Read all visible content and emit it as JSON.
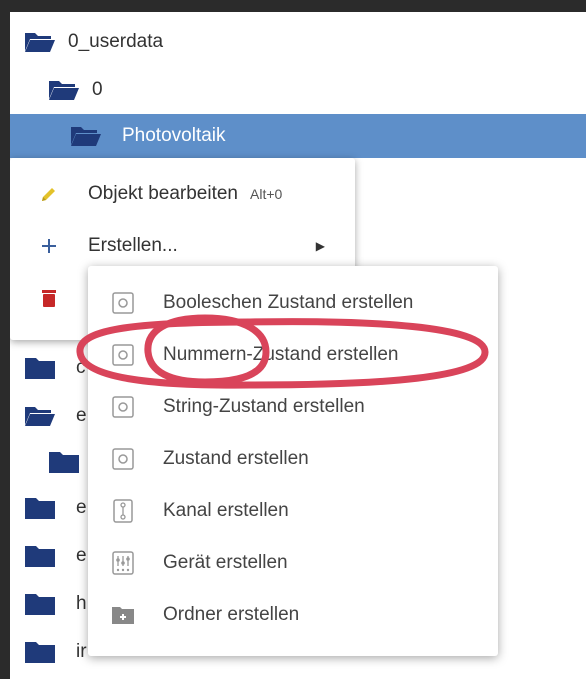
{
  "tree": {
    "items": [
      {
        "label": "0_userdata",
        "icon": "folder-open-icon"
      },
      {
        "label": "0",
        "icon": "folder-open-icon"
      },
      {
        "label": "Photovoltaik",
        "icon": "folder-open-icon",
        "selected": true
      }
    ],
    "partial_items": [
      {
        "label": "c",
        "icon": "folder-icon"
      },
      {
        "label": "e",
        "icon": "folder-open-icon"
      },
      {
        "label": "",
        "icon": "folder-icon"
      },
      {
        "label": "e",
        "icon": "folder-icon"
      },
      {
        "label": "e",
        "icon": "folder-icon"
      },
      {
        "label": "h",
        "icon": "folder-icon"
      },
      {
        "label": "ir",
        "icon": "folder-icon"
      }
    ]
  },
  "context_menu": {
    "items": [
      {
        "label": "Objekt bearbeiten",
        "shortcut": "Alt+0",
        "icon": "pencil-icon"
      },
      {
        "label": "Erstellen...",
        "icon": "plus-icon",
        "has_submenu": true
      },
      {
        "label": "",
        "icon": "trash-icon"
      }
    ]
  },
  "submenu": {
    "items": [
      {
        "label": "Booleschen Zustand erstellen",
        "icon": "state-icon"
      },
      {
        "label": "Nummern-Zustand erstellen",
        "icon": "state-icon",
        "highlighted_annotation": true
      },
      {
        "label": "String-Zustand erstellen",
        "icon": "state-icon"
      },
      {
        "label": "Zustand erstellen",
        "icon": "state-icon"
      },
      {
        "label": "Kanal erstellen",
        "icon": "channel-icon"
      },
      {
        "label": "Gerät erstellen",
        "icon": "device-icon"
      },
      {
        "label": "Ordner erstellen",
        "icon": "folder-add-icon"
      }
    ]
  },
  "colors": {
    "selected_row": "#5e8fc9",
    "folder": "#1f3a7a",
    "pencil": "#e3c22a",
    "trash": "#c62828",
    "annotation": "#d9445a"
  }
}
